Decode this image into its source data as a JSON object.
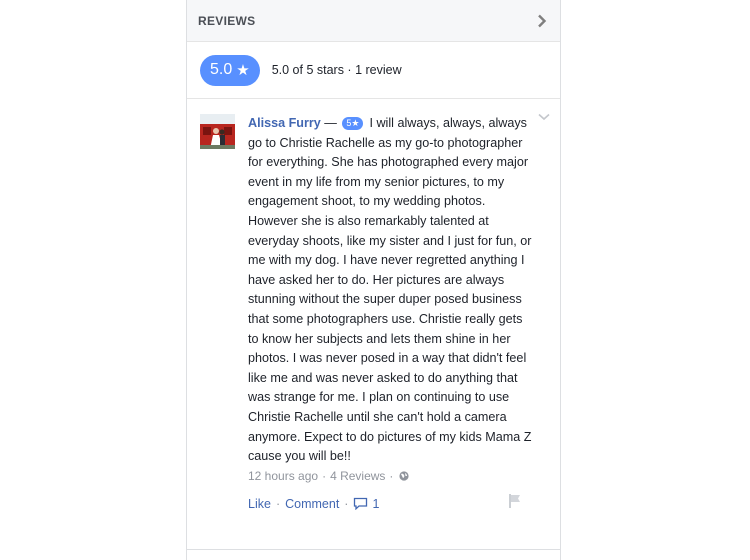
{
  "header": {
    "title": "REVIEWS",
    "chevron_icon": "chevron-right-icon"
  },
  "summary": {
    "score": "5.0",
    "star": "★",
    "text": "5.0 of 5 stars · 1 review"
  },
  "review": {
    "author": "Alissa Furry",
    "dash": " — ",
    "rating_badge": "5★",
    "text": "I will always, always, always go to Christie Rachelle as my go-to photographer for everything. She has photographed every major event in my life from my senior pictures, to my engagement shoot, to my wedding photos. However she is also remarkably talented at everyday shoots, like my sister and I just for fun, or me with my dog. I have never regretted anything I have asked her to do. Her pictures are always stunning without the super duper posed business that some photographers use. Christie really gets to know her subjects and lets them shine in her photos. I was never posed in a way that didn't feel like me and was never asked to do anything that was strange for me. I plan on continuing to use Christie Rachelle until she can't hold a camera anymore. Expect to do pictures of my kids Mama Z cause you will be!!",
    "time": "12 hours ago",
    "sep": "·",
    "review_count": "4 Reviews",
    "privacy_icon": "globe-icon"
  },
  "actions": {
    "like": "Like",
    "dot": "·",
    "comment": "Comment",
    "comment_count": "1"
  },
  "colors": {
    "accent": "#5890ff",
    "link": "#4267b2",
    "muted": "#90949c",
    "header_bg": "#f6f7f9"
  }
}
